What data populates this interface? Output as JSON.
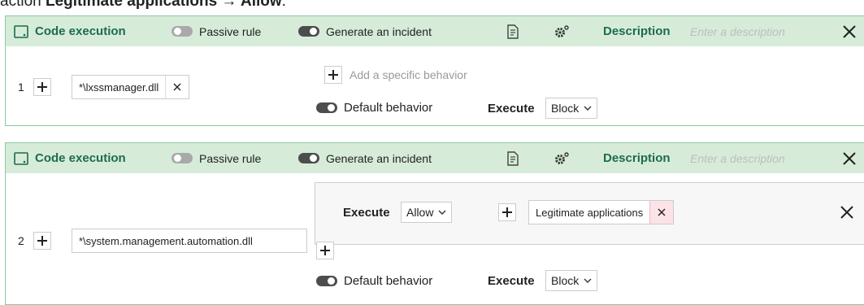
{
  "caption": {
    "prefix": "action ",
    "bold": "Legitimate applications → Allow",
    "suffix": "."
  },
  "rules": [
    {
      "header": {
        "title": "Code execution",
        "passive_label": "Passive rule",
        "incident_label": "Generate an incident",
        "description_label": "Description",
        "description_placeholder": "Enter a description"
      },
      "number": "1",
      "pattern": "*\\lxssmanager.dll",
      "add_behavior": "Add a specific behavior",
      "default_behavior": "Default behavior",
      "execute_label": "Execute",
      "execute_value": "Block"
    },
    {
      "header": {
        "title": "Code execution",
        "passive_label": "Passive rule",
        "incident_label": "Generate an incident",
        "description_label": "Description",
        "description_placeholder": "Enter a description"
      },
      "number": "2",
      "pattern": "*\\system.management.automation.dll",
      "exception": {
        "execute_label": "Execute",
        "execute_value": "Allow",
        "application": "Legitimate applications"
      },
      "default_behavior": "Default behavior",
      "execute_label": "Execute",
      "execute_value": "Block"
    }
  ],
  "colors": {
    "header_bg": "#d6ecd9",
    "title_green": "#1d6b4f",
    "card_border": "#8cc9a0",
    "remove_bg": "#fbe3e6"
  },
  "icons": [
    "code-execution-icon",
    "toggle-switch",
    "document-icon",
    "settings-icon",
    "close-icon",
    "plus-icon",
    "remove-icon",
    "chevron-down-icon"
  ]
}
